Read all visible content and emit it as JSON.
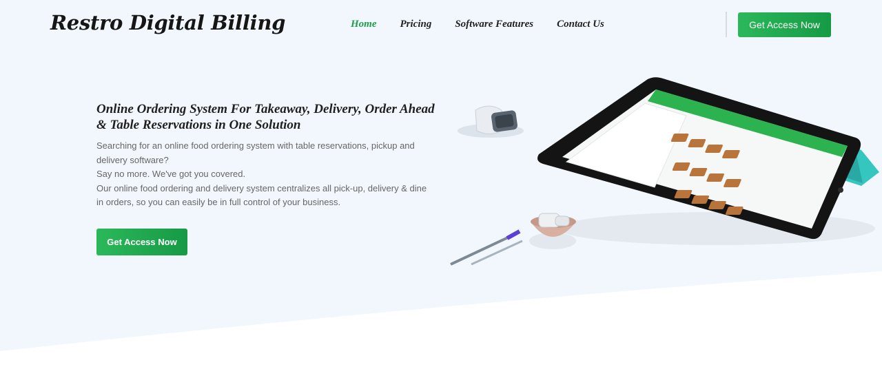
{
  "header": {
    "logo": "Restro Digital Billing",
    "nav": [
      {
        "label": "Home",
        "active": true
      },
      {
        "label": "Pricing",
        "active": false
      },
      {
        "label": "Software Features",
        "active": false
      },
      {
        "label": "Contact Us",
        "active": false
      }
    ],
    "cta_label": "Get Access Now"
  },
  "hero": {
    "title": "Online Ordering System For Takeaway, Delivery, Order Ahead & Table Reservations in One Solution",
    "paragraphs": [
      "Searching for an online food ordering system with table reservations, pickup and delivery software?",
      "Say no more. We've got you covered.",
      "Our online food ordering and delivery system centralizes all pick-up, delivery & dine in orders, so you can easily be in full control of your business."
    ],
    "cta_label": "Get Access Now"
  },
  "colors": {
    "accent": "#1f9d4a",
    "background": "#f1f7fd",
    "tablet_case": "#35c6c0"
  },
  "illustration": {
    "icons": [
      "smartwatch-icon",
      "tablet-pos-icon",
      "pen-icon",
      "bowl-icon"
    ]
  }
}
